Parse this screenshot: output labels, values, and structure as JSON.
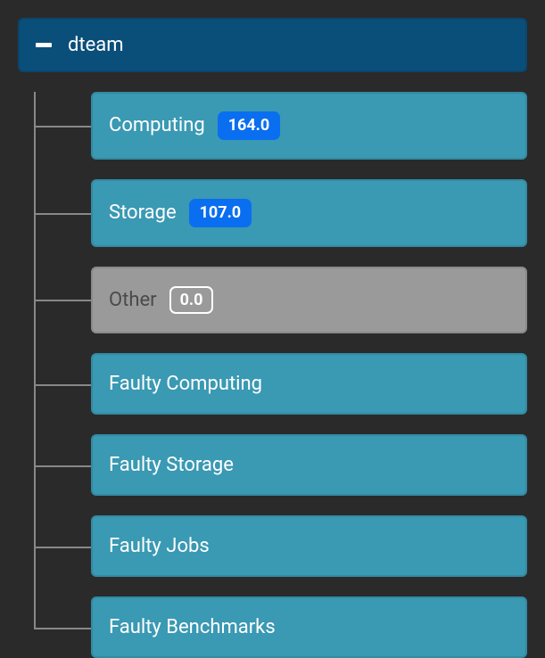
{
  "root": {
    "label": "dteam"
  },
  "children": [
    {
      "label": "Computing",
      "badge": "164.0",
      "badgeStyle": "blue",
      "style": "teal"
    },
    {
      "label": "Storage",
      "badge": "107.0",
      "badgeStyle": "blue",
      "style": "teal"
    },
    {
      "label": "Other",
      "badge": "0.0",
      "badgeStyle": "outline",
      "style": "gray"
    },
    {
      "label": "Faulty Computing",
      "badge": null,
      "badgeStyle": null,
      "style": "teal"
    },
    {
      "label": "Faulty Storage",
      "badge": null,
      "badgeStyle": null,
      "style": "teal"
    },
    {
      "label": "Faulty Jobs",
      "badge": null,
      "badgeStyle": null,
      "style": "teal"
    },
    {
      "label": "Faulty Benchmarks",
      "badge": null,
      "badgeStyle": null,
      "style": "teal"
    }
  ]
}
